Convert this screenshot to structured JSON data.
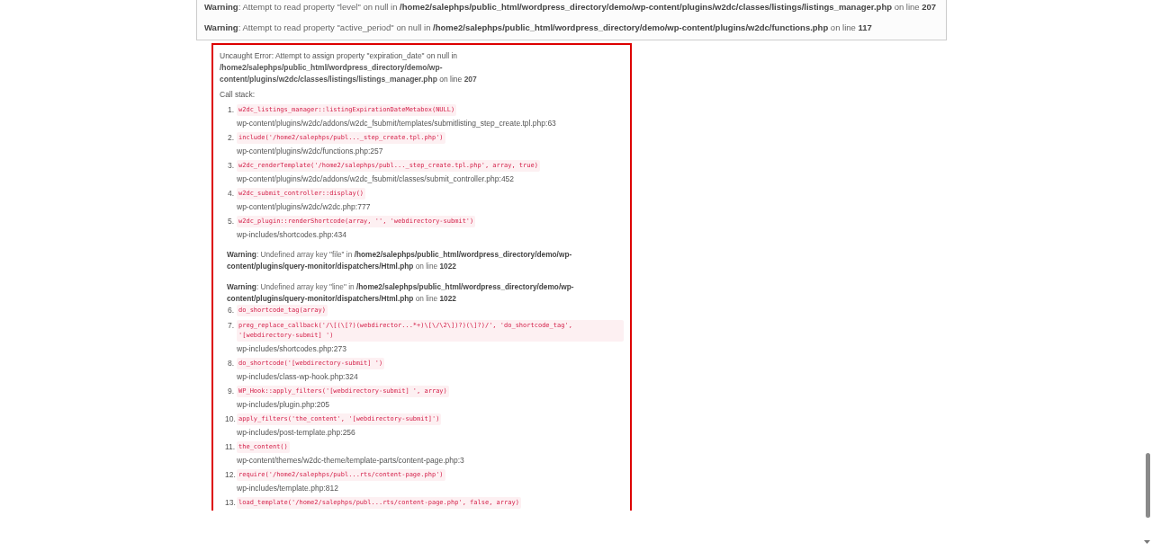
{
  "warnings": [
    "**Warning**: Attempt to read property \"level\" on null in **/home2/salephps/public_html/wordpress_directory/demo/wp-content/plugins/w2dc/classes/listings/listings_manager.php** on line **207**",
    "**Warning**: Attempt to read property \"active_period\" on null in **/home2/salephps/public_html/wordpress_directory/demo/wp-content/plugins/w2dc/functions.php** on line **117**"
  ],
  "error": {
    "message": "Uncaught Error: Attempt to assign property \"expiration_date\" on null in **/home2/salephps/public_html/wordpress_directory/demo/wp-content/plugins/w2dc/classes/listings/listings_manager.php** on line **207**",
    "call_stack_label": "Call stack:",
    "call_stack": [
      {
        "kind": "frame",
        "number": "1.",
        "code": "w2dc_listings_manager::listingExpirationDateMetabox(NULL)",
        "file": "wp-content/plugins/w2dc/addons/w2dc_fsubmit/templates/submitlisting_step_create.tpl.php:63"
      },
      {
        "kind": "frame",
        "number": "2.",
        "code": "include('/home2/salephps/publ..._step_create.tpl.php')",
        "file": "wp-content/plugins/w2dc/functions.php:257"
      },
      {
        "kind": "frame",
        "number": "3.",
        "code": "w2dc_renderTemplate('/home2/salephps/publ..._step_create.tpl.php', array, true)",
        "file": "wp-content/plugins/w2dc/addons/w2dc_fsubmit/classes/submit_controller.php:452"
      },
      {
        "kind": "frame",
        "number": "4.",
        "code": "w2dc_submit_controller::display()",
        "file": "wp-content/plugins/w2dc/w2dc.php:777"
      },
      {
        "kind": "frame",
        "number": "5.",
        "code": "w2dc_plugin::renderShortcode(array, '', 'webdirectory-submit')",
        "file": "wp-includes/shortcodes.php:434"
      },
      {
        "kind": "warning",
        "text": "**Warning**: Undefined array key \"file\" in **/home2/salephps/public_html/wordpress_directory/demo/wp-content/plugins/query-monitor/dispatchers/Html.php** on line **1022**"
      },
      {
        "kind": "warning",
        "text": "**Warning**: Undefined array key \"line\" in **/home2/salephps/public_html/wordpress_directory/demo/wp-content/plugins/query-monitor/dispatchers/Html.php** on line **1022**"
      },
      {
        "kind": "frame",
        "number": "6.",
        "code": "do_shortcode_tag(array)"
      },
      {
        "kind": "frame",
        "number": "7.",
        "code": "preg_replace_callback('/\\[(\\[?)(webdirector...*+)\\[\\/\\2\\])?)(\\]?)/', 'do_shortcode_tag', '[webdirectory-submit] ')",
        "file": "wp-includes/shortcodes.php:273"
      },
      {
        "kind": "frame",
        "number": "8.",
        "code": "do_shortcode('[webdirectory-submit] ')",
        "file": "wp-includes/class-wp-hook.php:324"
      },
      {
        "kind": "frame",
        "number": "9.",
        "code": "WP_Hook::apply_filters('[webdirectory-submit] ', array)",
        "file": "wp-includes/plugin.php:205"
      },
      {
        "kind": "frame",
        "number": "10.",
        "code": "apply_filters('the_content', '[webdirectory-submit]')",
        "file": "wp-includes/post-template.php:256"
      },
      {
        "kind": "frame",
        "number": "11.",
        "code": "the_content()",
        "file": "wp-content/themes/w2dc-theme/template-parts/content-page.php:3"
      },
      {
        "kind": "frame",
        "number": "12.",
        "code": "require('/home2/salephps/publ...rts/content-page.php')",
        "file": "wp-includes/template.php:812"
      },
      {
        "kind": "frame",
        "number": "13.",
        "code": "load_template('/home2/salephps/publ...rts/content-page.php', false, array)"
      }
    ]
  }
}
